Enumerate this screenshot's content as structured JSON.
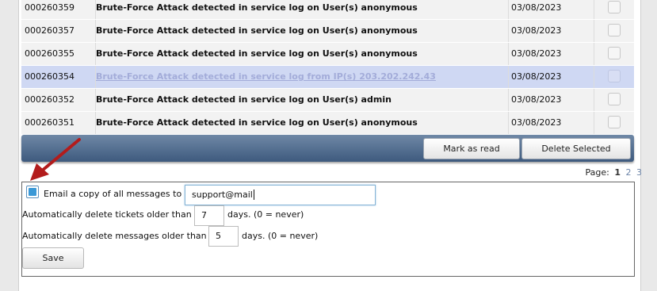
{
  "messages": [
    {
      "id": "000260359",
      "subject": "Brute-Force Attack detected in service log on User(s) anonymous",
      "date": "03/08/2023"
    },
    {
      "id": "000260357",
      "subject": "Brute-Force Attack detected in service log on User(s) anonymous",
      "date": "03/08/2023"
    },
    {
      "id": "000260355",
      "subject": "Brute-Force Attack detected in service log on User(s) anonymous",
      "date": "03/08/2023"
    },
    {
      "id": "000260354",
      "subject": "Brute-Force Attack detected in service log from IP(s) 203.202.242.43",
      "date": "03/08/2023"
    },
    {
      "id": "000260352",
      "subject": "Brute-Force Attack detected in service log on User(s) admin",
      "date": "03/08/2023"
    },
    {
      "id": "000260351",
      "subject": "Brute-Force Attack detected in service log on User(s) anonymous",
      "date": "03/08/2023"
    }
  ],
  "toolbar": {
    "mark_read": "Mark as read",
    "delete_selected": "Delete Selected"
  },
  "pager": {
    "label": "Page:",
    "current": "1",
    "pages": [
      "2",
      "3"
    ]
  },
  "settings": {
    "email_label": "Email a copy of all messages to",
    "email_value": "support@mail",
    "email_checked": true,
    "tickets_label": "Automatically delete tickets older than",
    "tickets_value": "7",
    "tickets_suffix": "days. (0 = never)",
    "messages_label": "Automatically delete messages older than",
    "messages_value": "5",
    "messages_suffix": "days. (0 = never)",
    "save_label": "Save"
  },
  "colors": {
    "toolbar": "#4a6688",
    "highlight_row": "#cfd8f3",
    "arrow": "#b31c1c",
    "checkbox_fill": "#3a98d6"
  }
}
